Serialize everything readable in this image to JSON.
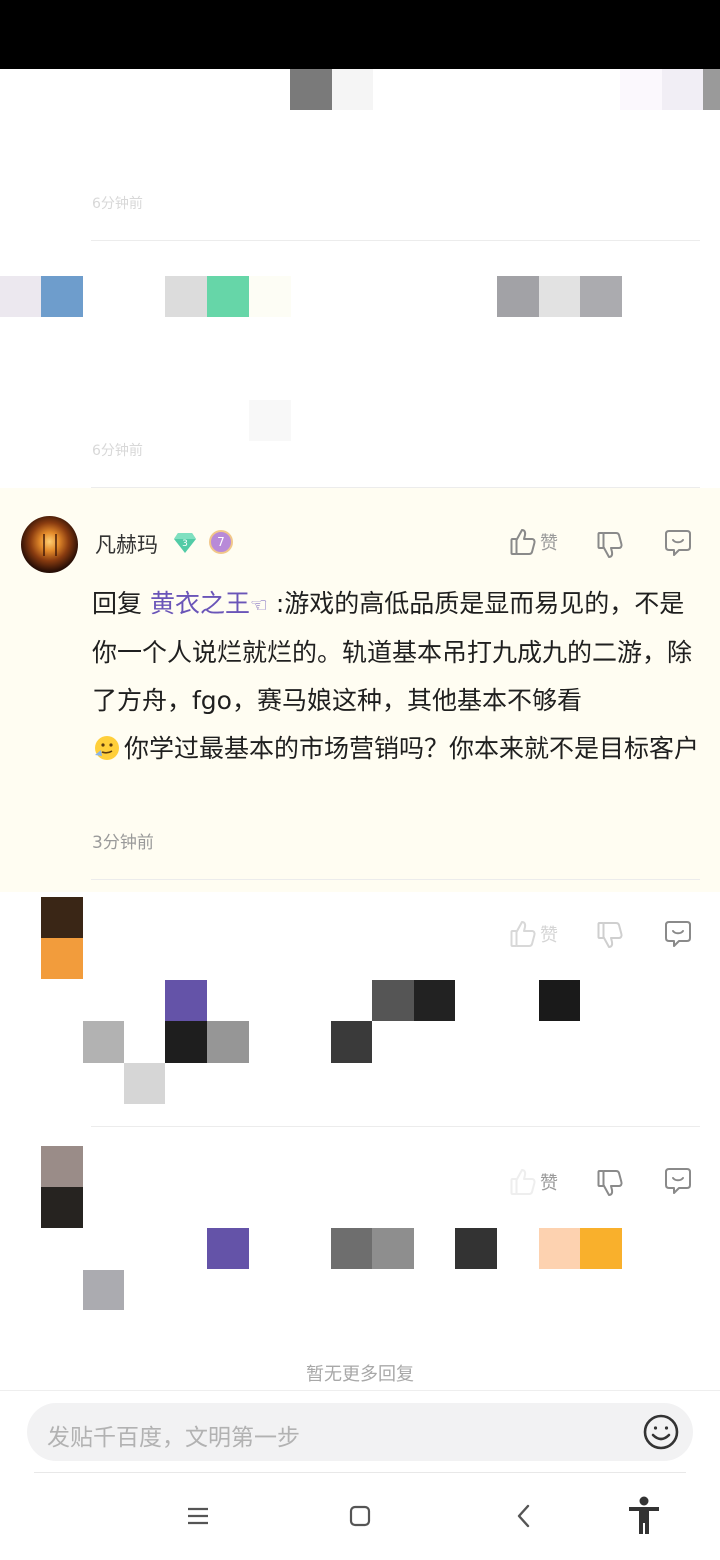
{
  "reply": {
    "username": "凡赫玛",
    "level": "3",
    "badge_level": "7",
    "like_label": "赞",
    "prefix": "回复 ",
    "mention": "黄衣之王",
    "mention_suffix": "☜",
    "text_part1": " :游戏的高低品质是显而易见的，不是你一个人说烂就烂的。轨道基本吊打九成九的二游，除了方舟，fgo，赛马娘这种，其他基本不够看",
    "text_part2": "你学过最基本的市场营销吗？你本来就不是目标客户",
    "time": "3分钟前"
  },
  "faded": {
    "time_1": "6分钟前",
    "time_2": "6分钟前",
    "like_label": "赞"
  },
  "footer": {
    "no_more": "暂无更多回复",
    "input_placeholder": "发贴千百度，文明第一步"
  },
  "icons": {
    "like": "thumb-up-icon",
    "dislike": "thumb-down-icon",
    "reply": "comment-icon",
    "emoji": "smiley-icon",
    "nav_menu": "menu-icon",
    "nav_home": "home-icon",
    "nav_back": "back-icon",
    "nav_accessibility": "accessibility-icon"
  }
}
